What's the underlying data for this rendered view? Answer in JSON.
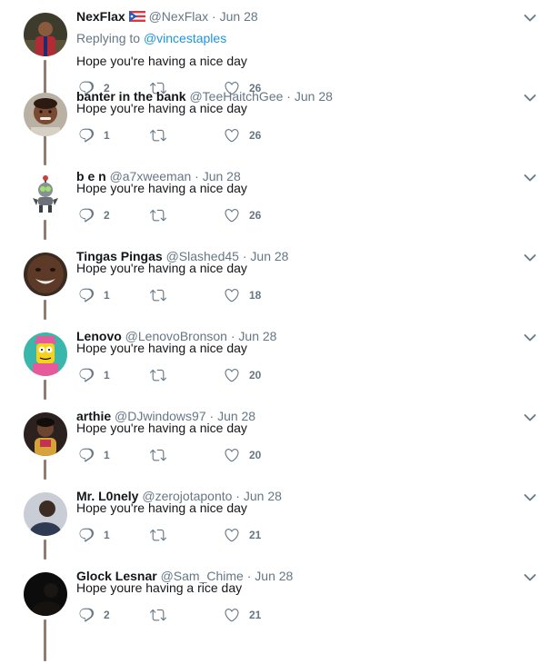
{
  "tweets": [
    {
      "name": "NexFlax",
      "handle": "@NexFlax",
      "date": "Jun 28",
      "has_flag": true,
      "reply_prefix": "Replying to ",
      "reply_to": "@vincestaples",
      "text": "Hope you're having a nice day",
      "replies": "2",
      "likes": "26",
      "avatar_color": "#3b3a2a"
    },
    {
      "name": "banter in the bank",
      "handle": "@TeeHaitchGee",
      "date": "Jun 28",
      "text": "Hope you're having a nice day",
      "replies": "1",
      "likes": "26",
      "avatar_color": "#b9b1a3"
    },
    {
      "name": "b e n",
      "handle": "@a7xweeman",
      "date": "Jun 28",
      "text": "Hope you're having a nice day",
      "replies": "2",
      "likes": "26",
      "avatar_color": "#ffffff"
    },
    {
      "name": "Tingas Pingas",
      "handle": "@Slashed45",
      "date": "Jun 28",
      "text": "Hope you're having a nice day",
      "replies": "1",
      "likes": "18",
      "avatar_color": "#5a3a26"
    },
    {
      "name": "Lenovo",
      "handle": "@LenovoBronson",
      "date": "Jun 28",
      "text": "Hope you're having a nice day",
      "replies": "1",
      "likes": "20",
      "avatar_color": "#39b6a8"
    },
    {
      "name": "arthie",
      "handle": "@DJwindows97",
      "date": "Jun 28",
      "text": "Hope you're having a nice day",
      "replies": "1",
      "likes": "20",
      "avatar_color": "#2b2220"
    },
    {
      "name": "Mr. L0nely",
      "handle": "@zerojotaponto",
      "date": "Jun 28",
      "text": "Hope you're having a nice day",
      "replies": "1",
      "likes": "21",
      "avatar_color": "#c9ced6"
    },
    {
      "name": "Glock Lesnar",
      "handle": "@Sam_Chime",
      "date": "Jun 28",
      "text": "Hope youre having a rice day",
      "replies": "2",
      "likes": "21",
      "avatar_color": "#0d0d0d"
    }
  ],
  "colors": {
    "name": "#14171a",
    "muted": "#657786",
    "link": "#1b95e0",
    "thread_line": "#8f7d74",
    "icon": "#657786"
  },
  "icons": {
    "reply": "reply-icon",
    "retweet": "retweet-icon",
    "like": "heart-icon",
    "more": "chevron-down-icon"
  }
}
